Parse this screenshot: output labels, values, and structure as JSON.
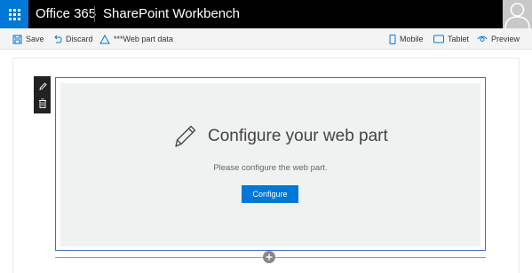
{
  "suite_bar": {
    "brand": "Office 365",
    "app_title": "SharePoint Workbench"
  },
  "command_bar": {
    "save_label": "Save",
    "discard_label": "Discard",
    "web_part_data_label": "***Web part data",
    "mobile_label": "Mobile",
    "tablet_label": "Tablet",
    "preview_label": "Preview"
  },
  "web_part": {
    "title": "Configure your web part",
    "description": "Please configure the web part.",
    "button_label": "Configure"
  },
  "colors": {
    "accent": "#0078d7",
    "suite_bar": "#000000",
    "selection_border": "#3b73c4",
    "placeholder_bg": "#f0f1f1"
  }
}
